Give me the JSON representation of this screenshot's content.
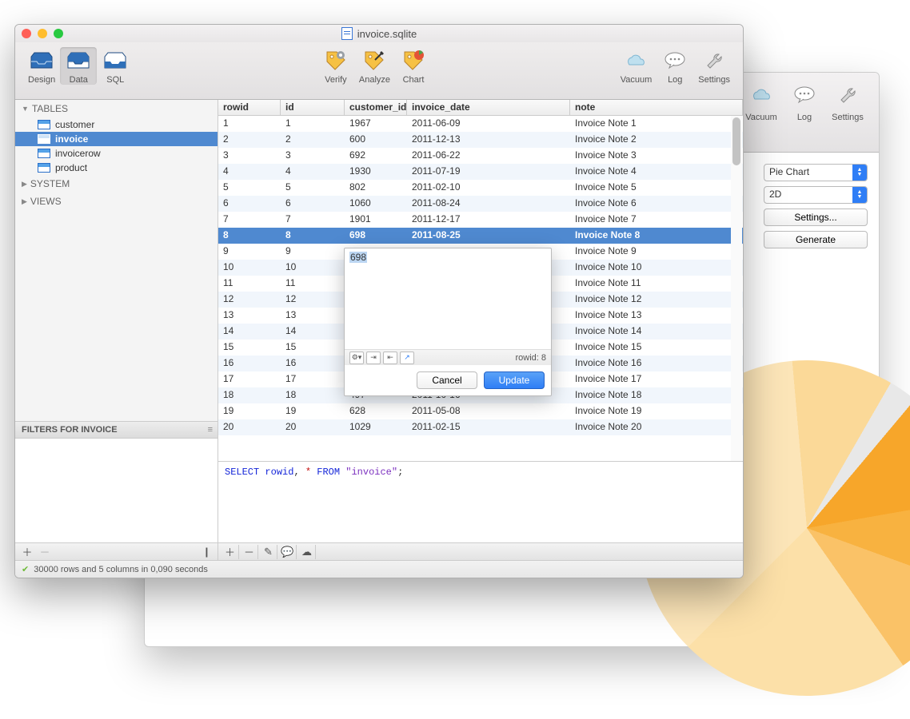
{
  "back": {
    "toolbar": {
      "vacuum": "Vacuum",
      "log": "Log",
      "settings": "Settings"
    },
    "controls": {
      "chartType": "Pie Chart",
      "dimension": "2D",
      "settingsBtn": "Settings...",
      "generateBtn": "Generate"
    }
  },
  "front": {
    "title": "invoice.sqlite",
    "toolbar": {
      "design": "Design",
      "data": "Data",
      "sql": "SQL",
      "verify": "Verify",
      "analyze": "Analyze",
      "chart": "Chart",
      "vacuum": "Vacuum",
      "log": "Log",
      "settings": "Settings"
    },
    "sidebar": {
      "tablesLabel": "TABLES",
      "tables": [
        "customer",
        "invoice",
        "invoicerow",
        "product"
      ],
      "selectedTable": "invoice",
      "systemLabel": "SYSTEM",
      "viewsLabel": "VIEWS",
      "filtersHeader": "FILTERS FOR INVOICE"
    },
    "grid": {
      "columns": [
        "rowid",
        "id",
        "customer_id",
        "invoice_date",
        "note"
      ],
      "selectedRowid": 8,
      "rows": [
        {
          "rowid": 1,
          "id": 1,
          "customer_id": "1967",
          "invoice_date": "2011-06-09",
          "note": "Invoice Note 1"
        },
        {
          "rowid": 2,
          "id": 2,
          "customer_id": "600",
          "invoice_date": "2011-12-13",
          "note": "Invoice Note 2"
        },
        {
          "rowid": 3,
          "id": 3,
          "customer_id": "692",
          "invoice_date": "2011-06-22",
          "note": "Invoice Note 3"
        },
        {
          "rowid": 4,
          "id": 4,
          "customer_id": "1930",
          "invoice_date": "2011-07-19",
          "note": "Invoice Note 4"
        },
        {
          "rowid": 5,
          "id": 5,
          "customer_id": "802",
          "invoice_date": "2011-02-10",
          "note": "Invoice Note 5"
        },
        {
          "rowid": 6,
          "id": 6,
          "customer_id": "1060",
          "invoice_date": "2011-08-24",
          "note": "Invoice Note 6"
        },
        {
          "rowid": 7,
          "id": 7,
          "customer_id": "1901",
          "invoice_date": "2011-12-17",
          "note": "Invoice Note 7"
        },
        {
          "rowid": 8,
          "id": 8,
          "customer_id": "698",
          "invoice_date": "2011-08-25",
          "note": "Invoice Note 8"
        },
        {
          "rowid": 9,
          "id": 9,
          "customer_id": "",
          "invoice_date": "",
          "note": "Invoice Note 9"
        },
        {
          "rowid": 10,
          "id": 10,
          "customer_id": "",
          "invoice_date": "",
          "note": "Invoice Note 10"
        },
        {
          "rowid": 11,
          "id": 11,
          "customer_id": "",
          "invoice_date": "",
          "note": "Invoice Note 11"
        },
        {
          "rowid": 12,
          "id": 12,
          "customer_id": "",
          "invoice_date": "",
          "note": "Invoice Note 12"
        },
        {
          "rowid": 13,
          "id": 13,
          "customer_id": "",
          "invoice_date": "",
          "note": "Invoice Note 13"
        },
        {
          "rowid": 14,
          "id": 14,
          "customer_id": "",
          "invoice_date": "",
          "note": "Invoice Note 14"
        },
        {
          "rowid": 15,
          "id": 15,
          "customer_id": "",
          "invoice_date": "",
          "note": "Invoice Note 15"
        },
        {
          "rowid": 16,
          "id": 16,
          "customer_id": "",
          "invoice_date": "",
          "note": "Invoice Note 16"
        },
        {
          "rowid": 17,
          "id": 17,
          "customer_id": "",
          "invoice_date": "",
          "note": "Invoice Note 17"
        },
        {
          "rowid": 18,
          "id": 18,
          "customer_id": "497",
          "invoice_date": "2011-10-16",
          "note": "Invoice Note 18"
        },
        {
          "rowid": 19,
          "id": 19,
          "customer_id": "628",
          "invoice_date": "2011-05-08",
          "note": "Invoice Note 19"
        },
        {
          "rowid": 20,
          "id": 20,
          "customer_id": "1029",
          "invoice_date": "2011-02-15",
          "note": "Invoice Note 20"
        }
      ]
    },
    "sqlText": {
      "select": "SELECT ",
      "rowid": "rowid",
      "comma": ", ",
      "star": "*",
      "from": " FROM ",
      "tbl": "\"invoice\"",
      "semi": ";"
    },
    "status": "30000 rows and 5 columns in 0,090 seconds",
    "editPopup": {
      "value": "698",
      "rowidLabel": "rowid: 8",
      "cancel": "Cancel",
      "update": "Update"
    }
  }
}
